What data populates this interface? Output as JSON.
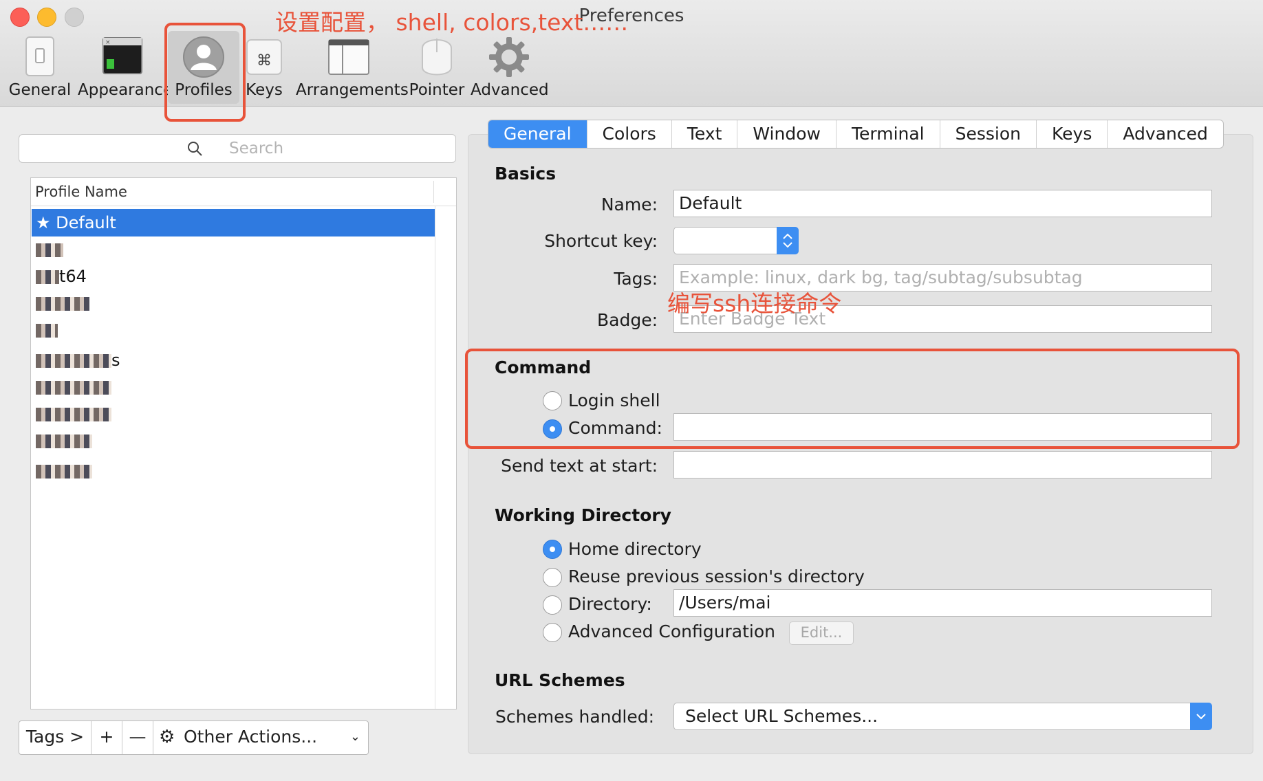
{
  "window": {
    "title": "Preferences"
  },
  "toolbar": {
    "items": [
      {
        "label": "General",
        "icon": "switch-icon"
      },
      {
        "label": "Appearance",
        "icon": "terminal-window-icon"
      },
      {
        "label": "Profiles",
        "icon": "person-silhouette-icon",
        "selected": true
      },
      {
        "label": "Keys",
        "icon": "command-key-icon"
      },
      {
        "label": "Arrangements",
        "icon": "window-layout-icon"
      },
      {
        "label": "Pointer",
        "icon": "mouse-icon"
      },
      {
        "label": "Advanced",
        "icon": "gear-icon"
      }
    ]
  },
  "annotations": {
    "top": "设置配置， shell, colors,text……",
    "command": "编写ssh连接命令",
    "color": "#e8533a"
  },
  "profiles": {
    "search_placeholder": "Search",
    "column_header": "Profile Name",
    "rows": [
      {
        "label": "★ Default",
        "selected": true
      },
      {
        "label": "",
        "obscured": true
      },
      {
        "label": "t64",
        "obscured": true
      },
      {
        "label": "",
        "obscured": true
      },
      {
        "label": "",
        "obscured": true
      },
      {
        "label": "s",
        "obscured": true
      },
      {
        "label": "",
        "obscured": true
      },
      {
        "label": "",
        "obscured": true
      },
      {
        "label": "",
        "obscured": true
      },
      {
        "label": "",
        "obscured": true
      }
    ],
    "bottom_bar": {
      "tags": "Tags >",
      "add": "+",
      "remove": "—",
      "other_actions": "Other Actions..."
    }
  },
  "tabs": [
    "General",
    "Colors",
    "Text",
    "Window",
    "Terminal",
    "Session",
    "Keys",
    "Advanced"
  ],
  "active_tab": "General",
  "basics": {
    "heading": "Basics",
    "name_label": "Name:",
    "name_value": "Default",
    "shortcut_label": "Shortcut key:",
    "shortcut_value": "",
    "tags_label": "Tags:",
    "tags_placeholder": "Example: linux, dark bg, tag/subtag/subsubtag",
    "badge_label": "Badge:",
    "badge_placeholder": "Enter Badge Text"
  },
  "command": {
    "heading": "Command",
    "login_shell_label": "Login shell",
    "command_label": "Command:",
    "command_value": "",
    "selected": "command",
    "send_text_label": "Send text at start:",
    "send_text_value": ""
  },
  "working_directory": {
    "heading": "Working Directory",
    "home_label": "Home directory",
    "reuse_label": "Reuse previous session's directory",
    "directory_label": "Directory:",
    "directory_value": "/Users/mai",
    "advanced_label": "Advanced Configuration",
    "edit_button": "Edit...",
    "selected": "home"
  },
  "url_schemes": {
    "heading": "URL Schemes",
    "schemes_label": "Schemes handled:",
    "schemes_value": "Select URL Schemes..."
  },
  "colors": {
    "accent": "#3d8ef2",
    "selection": "#2f7ae0",
    "annotation": "#e8533a"
  }
}
